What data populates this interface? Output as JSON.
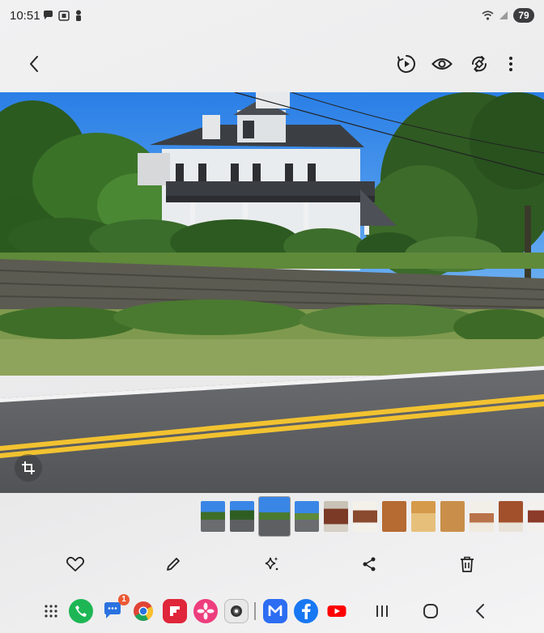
{
  "status_bar": {
    "time": "10:51",
    "battery": "79",
    "left_icons": [
      "chat-bubble-icon",
      "screenshot-icon",
      "person-icon"
    ],
    "right_icons": [
      "wifi-icon",
      "signal-icon",
      "battery-icon"
    ]
  },
  "toolbar": {
    "back_icon": "back-arrow-icon",
    "actions": [
      "motion-photo-icon",
      "eye-icon",
      "rotate-icon",
      "more-icon"
    ]
  },
  "photo": {
    "description_icon": "photo",
    "crop_icon": "crop-icon"
  },
  "thumbnails": {
    "count": 12,
    "active_index": 2
  },
  "action_bar": {
    "items": [
      "heart-icon",
      "pencil-icon",
      "sparkle-icon",
      "share-icon",
      "trash-icon"
    ]
  },
  "taskbar": {
    "apps": [
      "apps-grid-icon",
      "phone-app-icon",
      "messages-app-icon",
      "chrome-app-icon",
      "flipboard-app-icon",
      "gallery-app-icon",
      "camera-app-icon",
      "maps-app-icon",
      "facebook-app-icon",
      "youtube-app-icon"
    ],
    "messages_badge": "1",
    "nav": [
      "recents-icon",
      "home-icon",
      "nav-back-icon"
    ]
  },
  "colors": {
    "sky": "#2f86e8",
    "road": "#5d5f62",
    "yellow_line": "#f2c230",
    "badge": "#ea5a34"
  }
}
